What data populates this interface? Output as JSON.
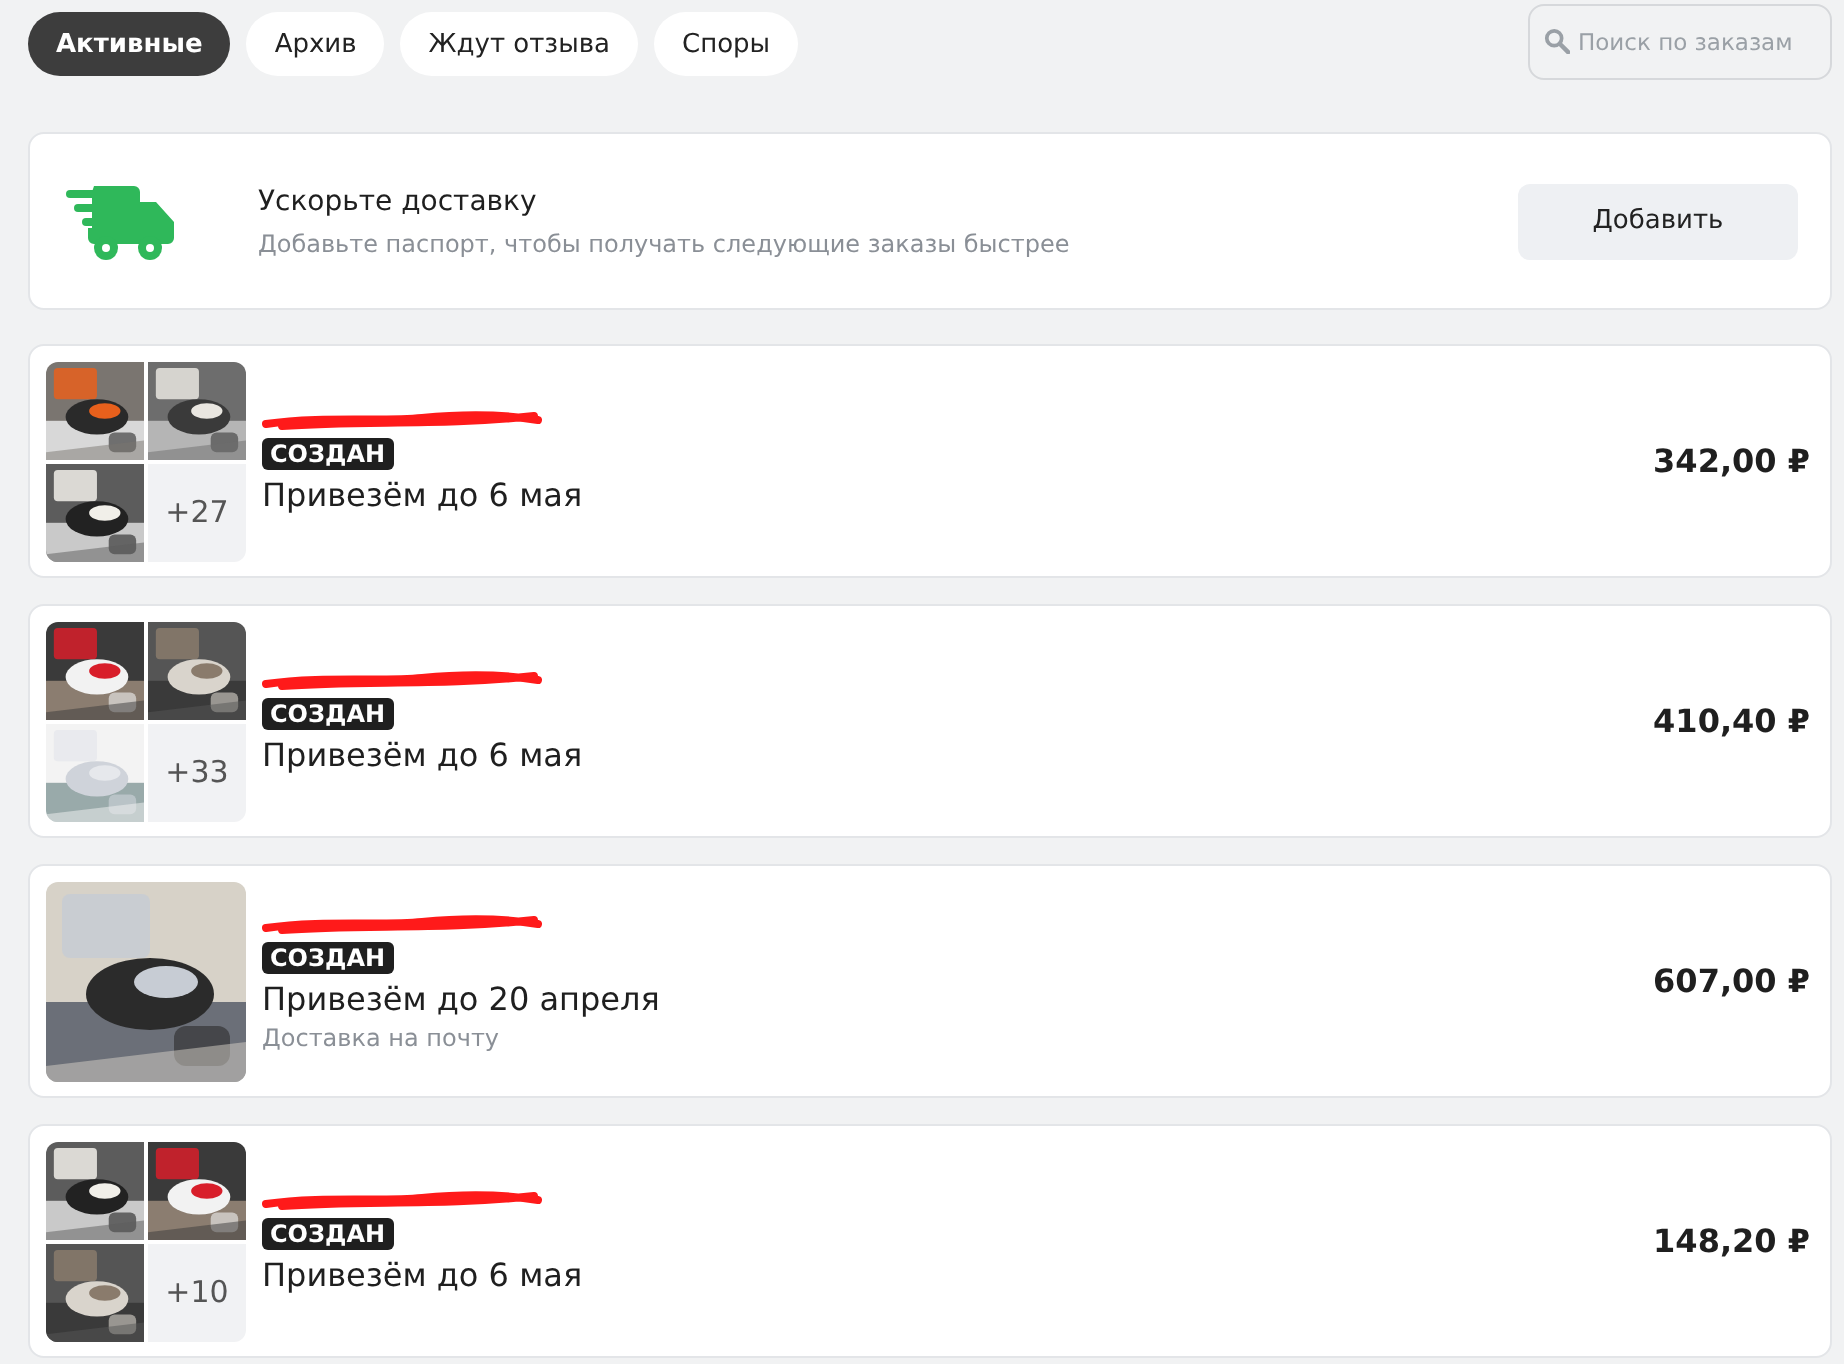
{
  "tabs": [
    {
      "label": "Активные",
      "selected": true
    },
    {
      "label": "Архив",
      "selected": false
    },
    {
      "label": "Ждут отзыва",
      "selected": false
    },
    {
      "label": "Споры",
      "selected": false
    }
  ],
  "search": {
    "placeholder": "Поиск по заказам"
  },
  "banner": {
    "title": "Ускорьте доставку",
    "text": "Добавьте паспорт, чтобы получать следующие заказы быстрее",
    "button": "Добавить"
  },
  "orders": [
    {
      "more": "+27",
      "status": "СОЗДАН",
      "delivery": "Привезём до 6 мая",
      "price": "342,00 ₽"
    },
    {
      "more": "+33",
      "status": "СОЗДАН",
      "delivery": "Привезём до 6 мая",
      "price": "410,40 ₽"
    },
    {
      "status": "СОЗДАН",
      "delivery": "Привезём до 20 апреля",
      "note": "Доставка на почту",
      "price": "607,00 ₽"
    },
    {
      "more": "+10",
      "status": "СОЗДАН",
      "delivery": "Привезём до 6 мая",
      "price": "148,20 ₽"
    }
  ]
}
